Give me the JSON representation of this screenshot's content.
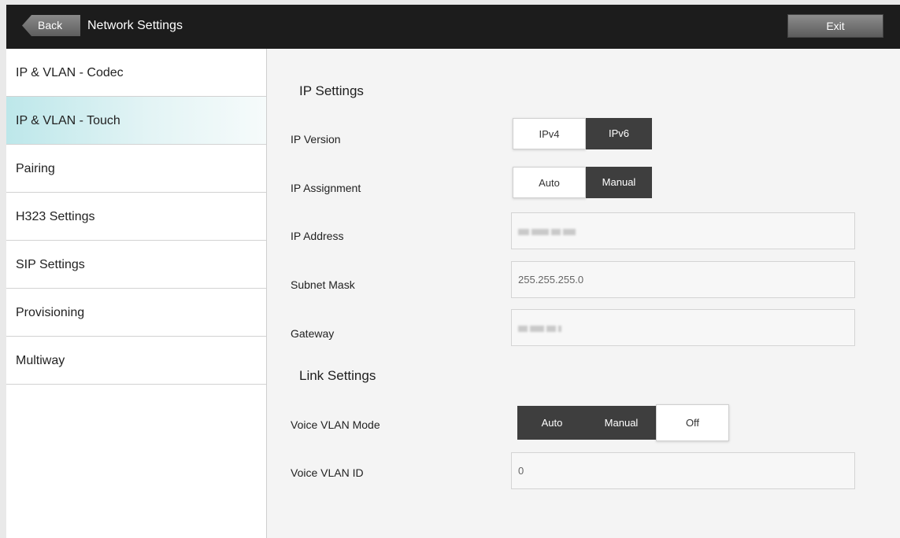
{
  "header": {
    "back_label": "Back",
    "title": "Network Settings",
    "exit_label": "Exit"
  },
  "sidebar": {
    "active_index": 1,
    "items": [
      {
        "label": "IP & VLAN - Codec"
      },
      {
        "label": "IP & VLAN - Touch"
      },
      {
        "label": "Pairing"
      },
      {
        "label": "H323 Settings"
      },
      {
        "label": "SIP Settings"
      },
      {
        "label": "Provisioning"
      },
      {
        "label": "Multiway"
      }
    ]
  },
  "ip_settings": {
    "title": "IP Settings",
    "ip_version": {
      "label": "IP Version",
      "options": [
        "IPv4",
        "IPv6"
      ],
      "selected": "IPv4"
    },
    "ip_assignment": {
      "label": "IP Assignment",
      "options": [
        "Auto",
        "Manual"
      ],
      "selected": "Auto"
    },
    "ip_address": {
      "label": "IP Address",
      "value": ""
    },
    "subnet_mask": {
      "label": "Subnet Mask",
      "value": "255.255.255.0"
    },
    "gateway": {
      "label": "Gateway",
      "value": ""
    }
  },
  "link_settings": {
    "title": "Link Settings",
    "voice_vlan_mode": {
      "label": "Voice VLAN Mode",
      "options": [
        "Auto",
        "Manual",
        "Off"
      ],
      "selected": "Off"
    },
    "voice_vlan_id": {
      "label": "Voice VLAN ID",
      "value": "0"
    }
  },
  "colors": {
    "topbar": "#1c1c1c",
    "active_item": "#bde7ea",
    "segment_dark": "#3e3e3e"
  }
}
